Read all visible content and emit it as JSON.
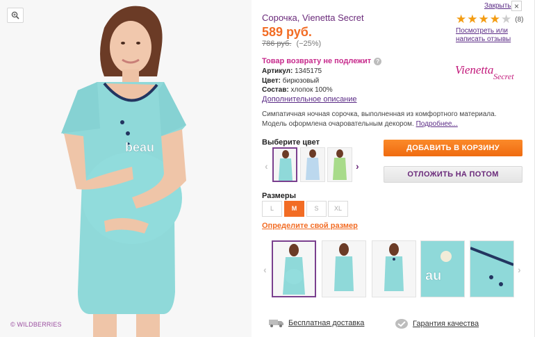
{
  "product": {
    "title": "Сорочка, Vienetta Secret",
    "price": "589 руб.",
    "old_price": "786 руб.",
    "discount": "(−25%)",
    "no_return": "Товар возврату не подлежит",
    "article_label": "Артикул:",
    "article_value": "1345175",
    "color_label": "Цвет:",
    "color_value": "бирюзовый",
    "composition_label": "Состав:",
    "composition_value": "хлопок 100%",
    "full_description_link": "Дополнительное описание",
    "description": "Симпатичная ночная сорочка, выполненная из комфортного материала. Модель оформлена очаровательным декором.",
    "more_link": "Подробнее..."
  },
  "header": {
    "close_label": "Закрыть",
    "close_icon": "close-icon"
  },
  "rating": {
    "stars_filled": 4,
    "stars_total": 5,
    "count": "(8)",
    "review_link": "Посмотреть или написать отзывы"
  },
  "brand": {
    "logo_text": "Vienetta Secret",
    "color": "#c2187a"
  },
  "colors": {
    "label": "Выберите цвет",
    "swatches": [
      "бирюзовый",
      "голубой",
      "зеленый"
    ],
    "selected_index": 0
  },
  "actions": {
    "add_to_cart": "ДОБАВИТЬ В КОРЗИНУ",
    "save_later": "ОТЛОЖИТЬ НА ПОТОМ"
  },
  "sizes": {
    "label": "Размеры",
    "options": [
      "L",
      "M",
      "S",
      "XL"
    ],
    "selected": "M",
    "size_link": "Определите свой размер"
  },
  "gallery": {
    "watermark": "© WILDBERRIES",
    "thumbnail_count": 5,
    "selected_index": 0
  },
  "footer": {
    "delivery": "Бесплатная доставка",
    "quality": "Гарантия качества"
  },
  "theme": {
    "accent_orange": "#f26c24",
    "accent_purple": "#6a2a7a",
    "gown_color": "#8fd9d9"
  }
}
